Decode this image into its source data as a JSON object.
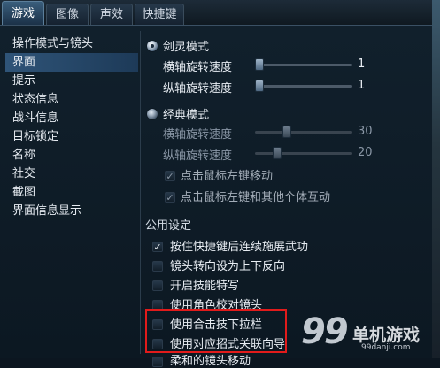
{
  "tabs": [
    {
      "label": "游戏",
      "active": true
    },
    {
      "label": "图像",
      "active": false
    },
    {
      "label": "声效",
      "active": false
    },
    {
      "label": "快捷键",
      "active": false
    }
  ],
  "sidebar": {
    "items": [
      {
        "label": "操作模式与镜头",
        "selected": false
      },
      {
        "label": "界面",
        "selected": true
      },
      {
        "label": "提示",
        "selected": false
      },
      {
        "label": "状态信息",
        "selected": false
      },
      {
        "label": "战斗信息",
        "selected": false
      },
      {
        "label": "目标锁定",
        "selected": false
      },
      {
        "label": "名称",
        "selected": false
      },
      {
        "label": "社交",
        "selected": false
      },
      {
        "label": "截图",
        "selected": false
      },
      {
        "label": "界面信息显示",
        "selected": false
      }
    ]
  },
  "mode_jianling": {
    "label": "剑灵模式",
    "selected": true,
    "h_rotate_label": "横轴旋转速度",
    "h_rotate_value": "1",
    "h_rotate_level": 0.0,
    "v_rotate_label": "纵轴旋转速度",
    "v_rotate_value": "1",
    "v_rotate_level": 0.0
  },
  "mode_classic": {
    "label": "经典模式",
    "selected": false,
    "h_rotate_label": "横轴旋转速度",
    "h_rotate_value": "30",
    "h_rotate_level": 0.3,
    "v_rotate_label": "纵轴旋转速度",
    "v_rotate_value": "20",
    "v_rotate_level": 0.2,
    "opt_left_move": "点击鼠标左键移动",
    "opt_left_interact": "点击鼠标左键和其他个体互动"
  },
  "public_settings": {
    "title": "公用设定",
    "options": [
      {
        "label": "按住快捷键后连续施展武功",
        "checked": true
      },
      {
        "label": "镜头转向设为上下反向",
        "checked": false
      },
      {
        "label": "开启技能特写",
        "checked": false
      },
      {
        "label": "使用角色校对镜头",
        "checked": false
      },
      {
        "label": "使用合击技下拉栏",
        "checked": false
      },
      {
        "label": "使用对应招式关联向导",
        "checked": false
      },
      {
        "label": "柔和的镜头移动",
        "checked": false
      }
    ]
  },
  "watermark": {
    "logo_digits": "99",
    "site_name": "单机游戏",
    "url": "99danji.com"
  },
  "colors": {
    "highlight_box": "#e11b1b",
    "selected_sidebar": "#2f5478"
  }
}
